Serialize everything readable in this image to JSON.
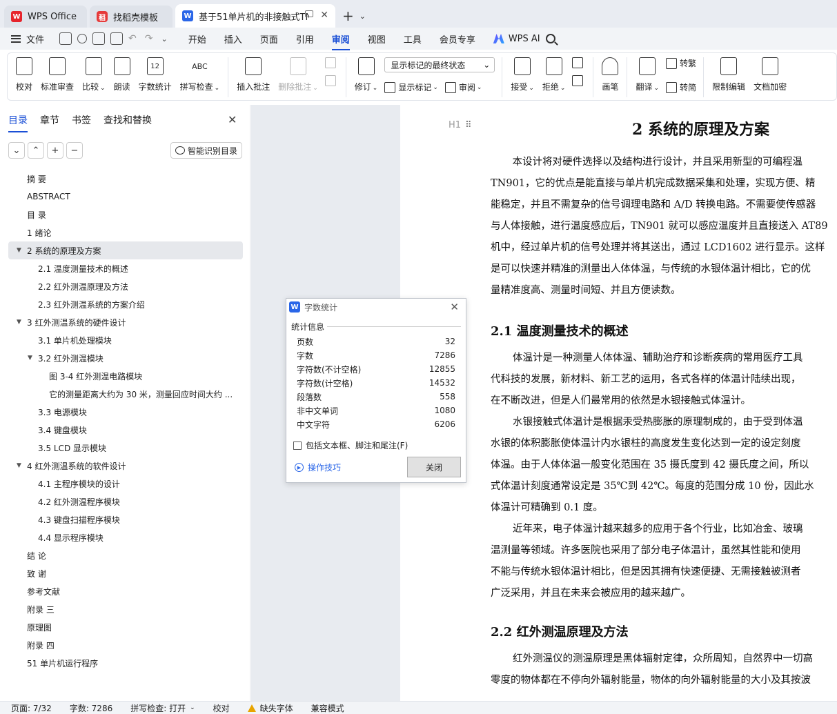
{
  "tabs": [
    {
      "label": "WPS Office",
      "icon": "wps-logo-icon"
    },
    {
      "label": "找稻壳模板",
      "icon": "docer-logo-icon"
    },
    {
      "label": "基于51单片机的非接触式TN90",
      "icon": "writer-doc-icon"
    }
  ],
  "menu": {
    "file": "文件",
    "items": [
      "开始",
      "插入",
      "页面",
      "引用",
      "审阅",
      "视图",
      "工具",
      "会员专享"
    ],
    "active": "审阅",
    "ai": "WPS AI"
  },
  "ribbon": {
    "proofread": "校对",
    "std_review": "标准审查",
    "compare": "比较",
    "read_aloud": "朗读",
    "word_count": "字数统计",
    "spell_check": "拼写检查",
    "insert_comment": "插入批注",
    "delete_comment": "删除批注",
    "revise": "修订",
    "markup_select": "显示标记的最终状态",
    "show_markup": "显示标记",
    "review": "审阅",
    "accept": "接受",
    "reject": "拒绝",
    "pen": "画笔",
    "translate": "翻译",
    "to_traditional": "转繁",
    "to_simplified": "转简",
    "restrict_edit": "限制编辑",
    "doc_encrypt": "文档加密",
    "word_count_icon_text": "12",
    "spell_icon_text": "ABC"
  },
  "nav": {
    "tabs": [
      "目录",
      "章节",
      "书签",
      "查找和替换"
    ],
    "smart_toc": "智能识别目录",
    "toc": [
      {
        "label": "摘  要",
        "level": 0
      },
      {
        "label": "ABSTRACT",
        "level": 0
      },
      {
        "label": "目  录",
        "level": 0
      },
      {
        "label": "1 绪论",
        "level": 0
      },
      {
        "label": "2  系统的原理及方案",
        "level": 0,
        "expanded": true,
        "selected": true
      },
      {
        "label": "2.1 温度测量技术的概述",
        "level": 1
      },
      {
        "label": "2.2  红外测温原理及方法",
        "level": 1
      },
      {
        "label": "2.3  红外测温系统的方案介绍",
        "level": 1
      },
      {
        "label": "3  红外测温系统的硬件设计",
        "level": 0,
        "expanded": true
      },
      {
        "label": "3.1  单片机处理模块",
        "level": 1
      },
      {
        "label": "3.2  红外测温模块",
        "level": 1,
        "expanded": true
      },
      {
        "label": "图 3-4  红外测温电路模块",
        "level": 2
      },
      {
        "label": "它的测量距离大约为 30 米，测量回应时间大约 ...",
        "level": 2
      },
      {
        "label": "3.3  电源模块",
        "level": 1
      },
      {
        "label": "3.4  键盘模块",
        "level": 1
      },
      {
        "label": "3.5 LCD 显示模块",
        "level": 1
      },
      {
        "label": "4  红外测温系统的软件设计",
        "level": 0,
        "expanded": true
      },
      {
        "label": "4.1  主程序模块的设计",
        "level": 1
      },
      {
        "label": "4.2  红外测温程序模块",
        "level": 1
      },
      {
        "label": "4.3  键盘扫描程序模块",
        "level": 1
      },
      {
        "label": "4.4  显示程序模块",
        "level": 1
      },
      {
        "label": "结  论",
        "level": 0
      },
      {
        "label": "致  谢",
        "level": 0
      },
      {
        "label": "参考文献",
        "level": 0
      },
      {
        "label": "附录 三",
        "level": 0
      },
      {
        "label": "原理图",
        "level": 0
      },
      {
        "label": "附录  四",
        "level": 0
      },
      {
        "label": "51 单片机运行程序",
        "level": 0
      }
    ]
  },
  "document": {
    "heading_mark": "H1",
    "h1": "2  系统的原理及方案",
    "p1": [
      "　本设计将对硬件选择以及结构进行设计，并且采用新型的可编程温",
      "TN901，它的优点是能直接与单片机完成数据采集和处理，实现方便、精",
      "能稳定，并且不需复杂的信号调理电路和 A/D 转换电路。不需要使传感器",
      "与人体接触，进行温度感应后，TN901 就可以感应温度并且直接送入 AT89",
      "机中，经过单片机的信号处理并将其送出，通过 LCD1602 进行显示。这样",
      "是可以快速并精准的测量出人体体温，与传统的水银体温计相比，它的优",
      "量精准度高、测量时间短、并且方便读数。"
    ],
    "h2_1": "2.1 温度测量技术的概述",
    "p2": [
      "体温计是一种测量人体体温、辅助治疗和诊断疾病的常用医疗工具",
      "代科技的发展，新材料、新工艺的运用，各式各样的体温计陆续出现，",
      "在不断改进，但是人们最常用的依然是水银接触式体温计。"
    ],
    "p3": [
      "水银接触式体温计是根据汞受热膨胀的原理制成的，由于受到体温",
      "水银的体积膨胀使体温计内水银柱的高度发生变化达到一定的设定刻度",
      "体温。由于人体体温一般变化范围在 35 摄氏度到 42 摄氏度之间，所以",
      "式体温计刻度通常设定是 35℃到 42℃。每度的范围分成 10 份，因此水",
      "体温计可精确到 0.1 度。"
    ],
    "p4": [
      "近年来，电子体温计越来越多的应用于各个行业，比如冶金、玻璃",
      "温测量等领域。许多医院也采用了部分电子体温计，虽然其性能和使用",
      "不能与传统水银体温计相比，但是因其拥有快速便捷、无需接触被测者",
      "广泛采用，并且在未来会被应用的越来越广。"
    ],
    "h2_2": "2.2  红外测温原理及方法",
    "p5": [
      "红外测温仪的测温原理是黑体辐射定律，众所周知，自然界中一切高",
      "零度的物体都在不停向外辐射能量，物体的向外辐射能量的大小及其按波"
    ]
  },
  "dialog": {
    "title": "字数统计",
    "section": "统计信息",
    "stats": [
      {
        "label": "页数",
        "value": "32"
      },
      {
        "label": "字数",
        "value": "7286"
      },
      {
        "label": "字符数(不计空格)",
        "value": "12855"
      },
      {
        "label": "字符数(计空格)",
        "value": "14532"
      },
      {
        "label": "段落数",
        "value": "558"
      },
      {
        "label": "非中文单词",
        "value": "1080"
      },
      {
        "label": "中文字符",
        "value": "6206"
      }
    ],
    "include_label": "包括文本框、脚注和尾注(F)",
    "tips": "操作技巧",
    "close": "关闭"
  },
  "status": {
    "page": "页面: 7/32",
    "words": "字数: 7286",
    "spell": "拼写检查: 打开",
    "proof": "校对",
    "missing_font": "缺失字体",
    "compat": "兼容模式"
  }
}
